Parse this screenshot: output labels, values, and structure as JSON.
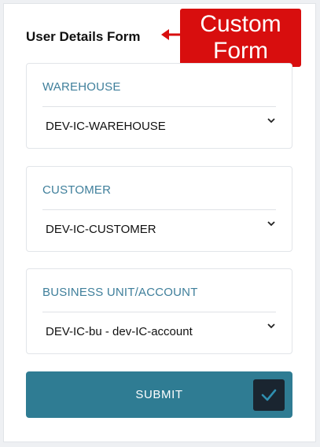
{
  "form": {
    "title": "User Details Form"
  },
  "callout": {
    "line1": "Custom",
    "line2": "Form",
    "color": "#d80e0e"
  },
  "fields": [
    {
      "label": "WAREHOUSE",
      "value": "DEV-IC-WAREHOUSE",
      "icon": "chevron-down-icon"
    },
    {
      "label": "CUSTOMER",
      "value": "DEV-IC-CUSTOMER",
      "icon": "chevron-down-icon"
    },
    {
      "label": "BUSINESS UNIT/ACCOUNT",
      "value": "DEV-IC-bu - dev-IC-account",
      "icon": "chevron-down-icon"
    }
  ],
  "submit": {
    "label": "SUBMIT",
    "icon": "checkmark-icon",
    "color": "#2f7c93"
  },
  "colors": {
    "label_text": "#3f7f9b",
    "check_box_bg": "#1a2530"
  }
}
